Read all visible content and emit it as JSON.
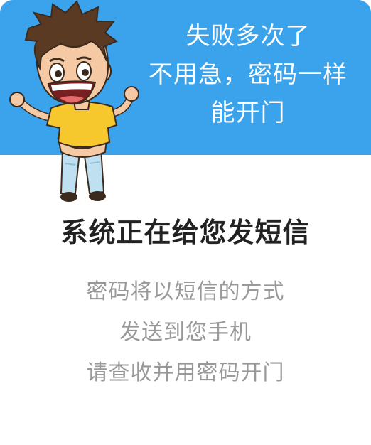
{
  "banner": {
    "lines": [
      "失败多次了",
      "不用急，密码一样",
      "能开门"
    ]
  },
  "title": "系统正在给您发短信",
  "description": {
    "lines": [
      "密码将以短信的方式",
      "发送到您手机",
      "请查收并用密码开门"
    ]
  },
  "colors": {
    "banner_bg": "#3aa3ec",
    "title": "#222222",
    "description": "#999999"
  },
  "icons": {
    "mascot": "cartoon-boy-illustration"
  }
}
